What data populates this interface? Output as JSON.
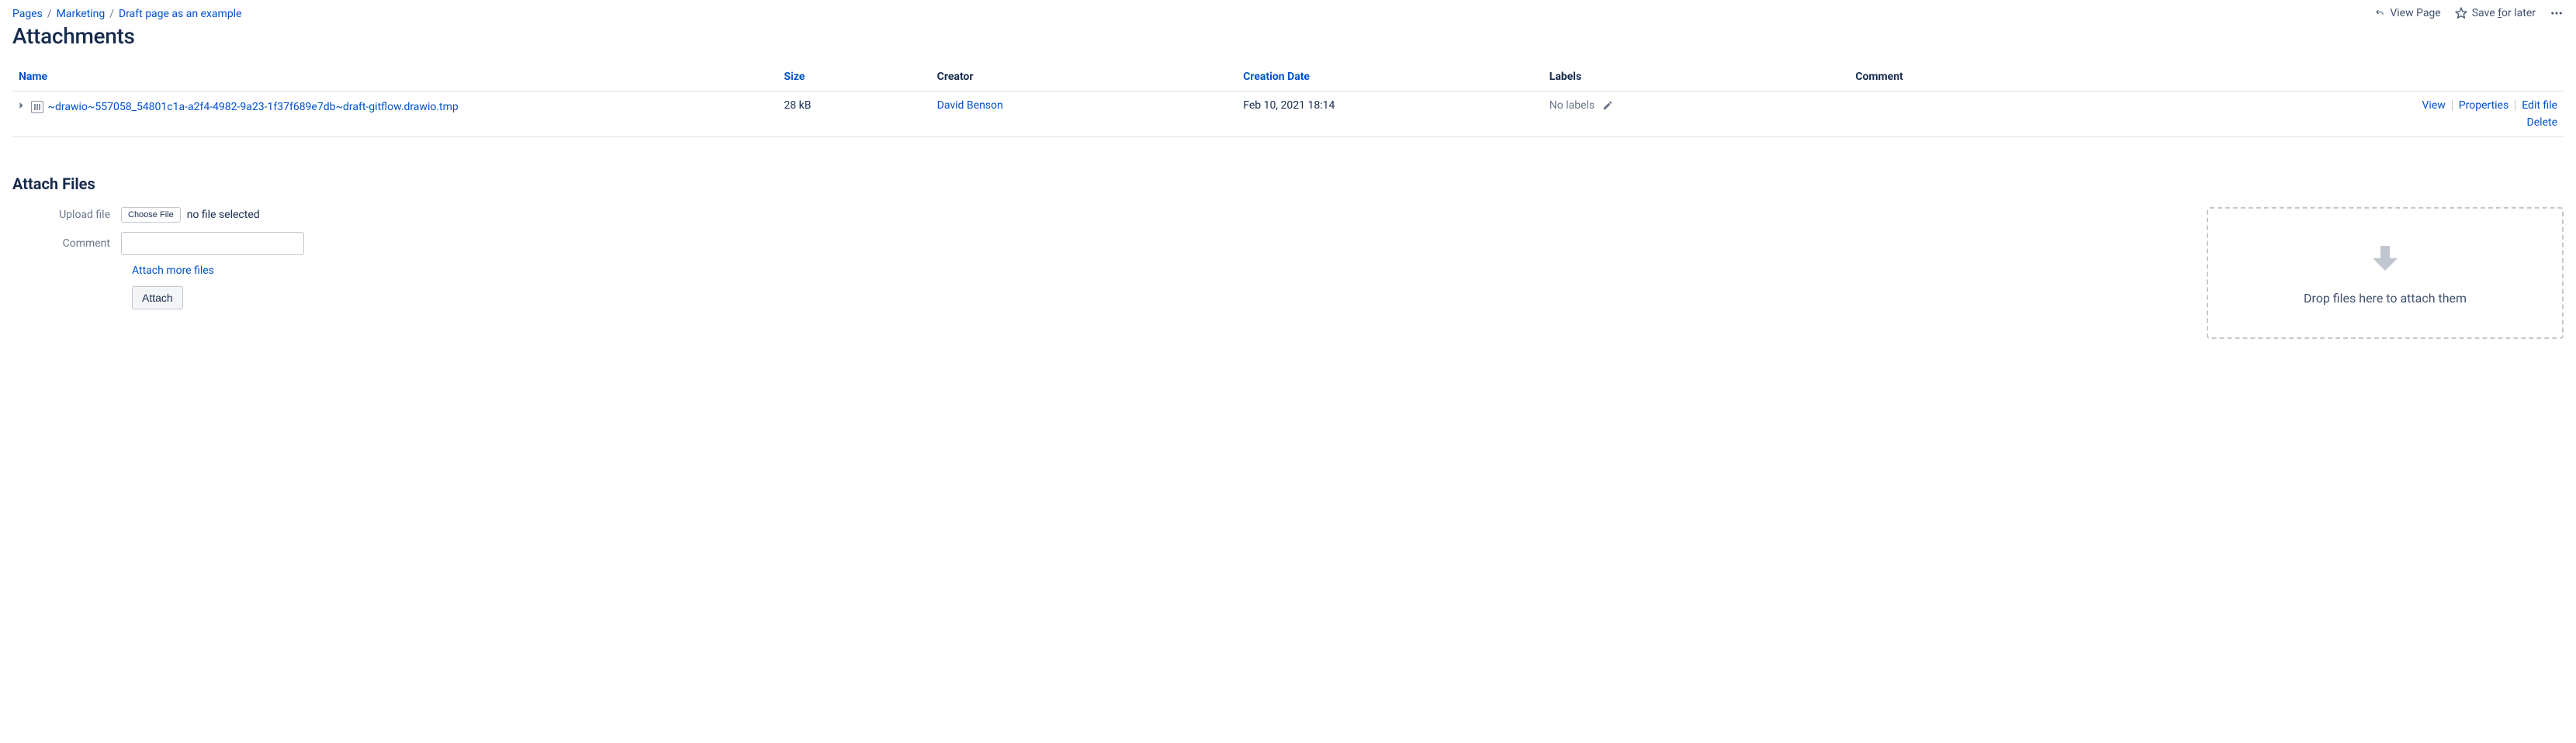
{
  "breadcrumb": [
    {
      "label": "Pages"
    },
    {
      "label": "Marketing"
    },
    {
      "label": "Draft page as an example"
    }
  ],
  "headerActions": {
    "viewPage": "View Page",
    "saveForLater_pre": "Save ",
    "saveForLater_u": "f",
    "saveForLater_post": "or later"
  },
  "pageTitle": "Attachments",
  "table": {
    "headers": {
      "name": "Name",
      "size": "Size",
      "creator": "Creator",
      "creationDate": "Creation Date",
      "labels": "Labels",
      "comment": "Comment"
    },
    "rows": [
      {
        "name": "~drawio~557058_54801c1a-a2f4-4982-9a23-1f37f689e7db~draft-gitflow.drawio.tmp",
        "size": "28 kB",
        "creator": "David Benson",
        "creationDate": "Feb 10, 2021 18:14",
        "labels": "No labels",
        "comment": "",
        "actions": {
          "view": "View",
          "properties": "Properties",
          "edit": "Edit file",
          "delete": "Delete"
        }
      }
    ]
  },
  "attachSection": {
    "heading": "Attach Files",
    "uploadLabel": "Upload file",
    "chooseFile": "Choose File",
    "noFileSelected": "no file selected",
    "commentLabel": "Comment",
    "attachMore": "Attach more files",
    "attachButton": "Attach",
    "dropzoneText": "Drop files here to attach them"
  }
}
